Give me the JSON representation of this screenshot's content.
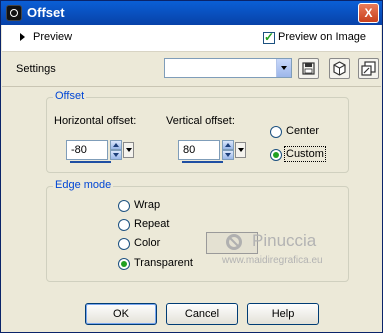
{
  "window": {
    "title": "Offset",
    "close_glyph": "X",
    "icon": "app-icon"
  },
  "preview": {
    "label": "Preview",
    "preview_on_image_label": "Preview on Image",
    "preview_on_image_checked": true
  },
  "settings": {
    "label": "Settings",
    "preset_value": "",
    "icons": [
      "save-preset-icon",
      "randomize-icon",
      "reset-icon"
    ]
  },
  "offset": {
    "legend": "Offset",
    "horizontal_label": "Horizontal offset:",
    "horizontal_value": "-80",
    "vertical_label": "Vertical offset:",
    "vertical_value": "80",
    "center_label": "Center",
    "custom_label": "Custom",
    "selected": "Custom"
  },
  "edge_mode": {
    "legend": "Edge mode",
    "options": [
      "Wrap",
      "Repeat",
      "Color",
      "Transparent"
    ],
    "selected": "Transparent"
  },
  "watermark": {
    "name": "Pinuccia",
    "url": "www.maidiregrafica.eu"
  },
  "buttons": {
    "ok": "OK",
    "cancel": "Cancel",
    "help": "Help"
  },
  "colors": {
    "titlebar": "#0842a8",
    "accent": "#0046d5",
    "radio_on": "#22a022"
  }
}
